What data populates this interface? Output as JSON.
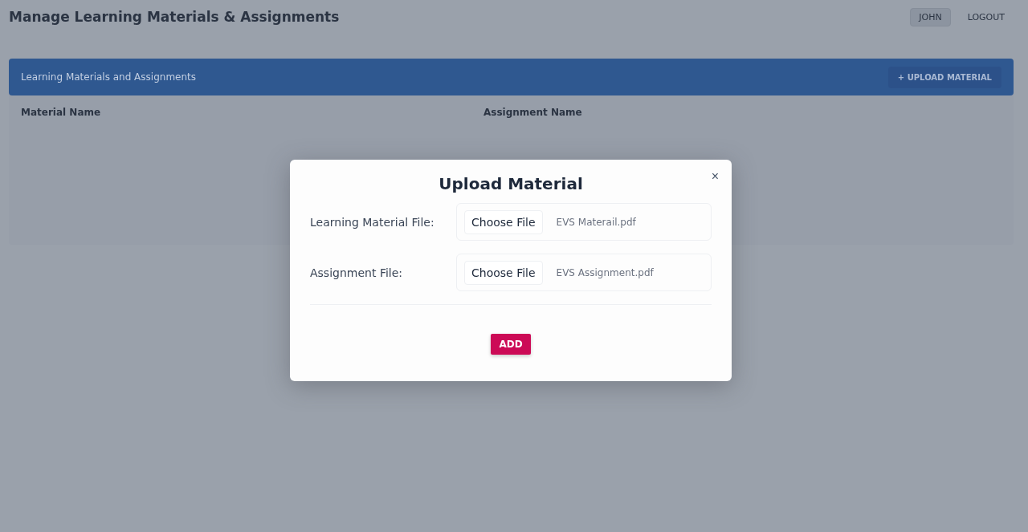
{
  "page": {
    "title": "Manage Learning Materials & Assignments"
  },
  "nav": [
    {
      "label": "JOHN",
      "selected": true
    },
    {
      "label": "LOGOUT",
      "selected": false
    }
  ],
  "panel": {
    "title": "Learning Materials and Assignments",
    "action": "+ UPLOAD MATERIAL",
    "columns": [
      "Material Name",
      "Assignment Name"
    ]
  },
  "modal": {
    "title": "Upload Material",
    "close": "×",
    "fields": [
      {
        "label": "Learning Material File:",
        "button": "Choose File",
        "value": "EVS Materail.pdf"
      },
      {
        "label": "Assignment File:",
        "button": "Choose File",
        "value": "EVS Assignment.pdf"
      }
    ],
    "submit": "ADD"
  }
}
